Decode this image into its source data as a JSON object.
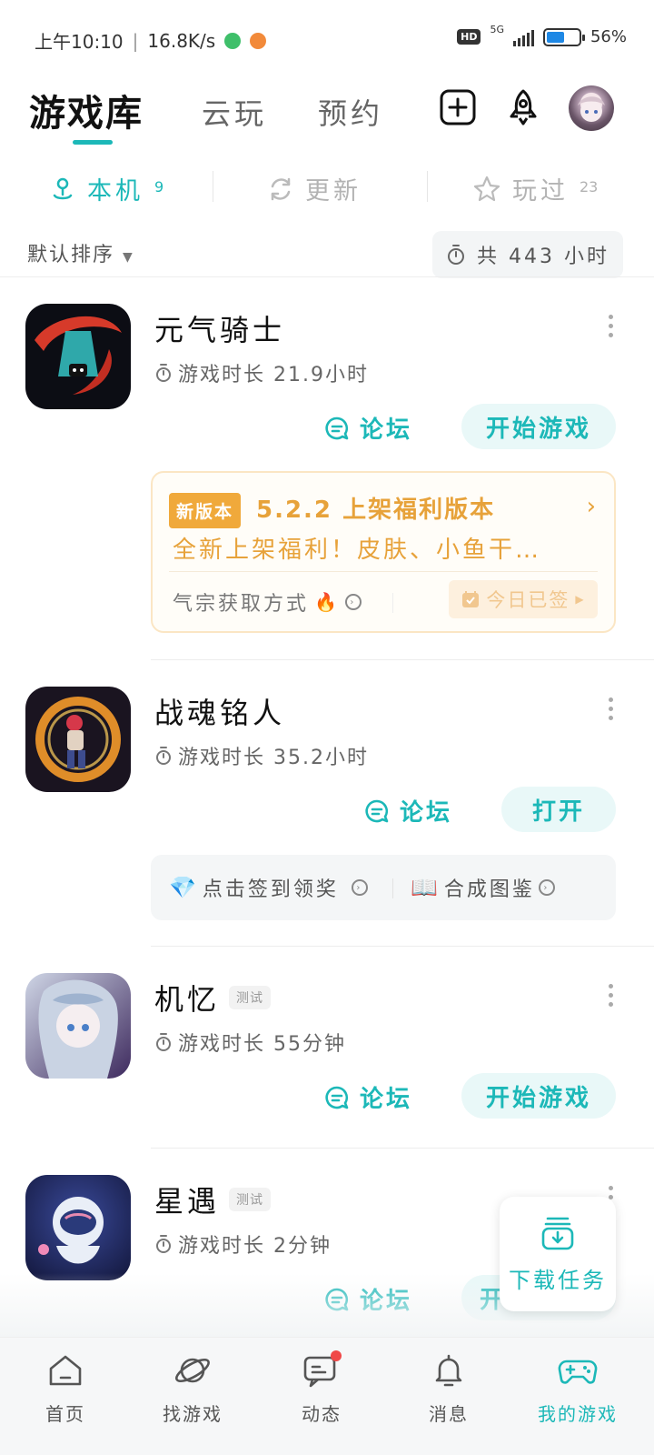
{
  "status_bar": {
    "time": "上午10:10",
    "speed": "16.8K/s",
    "network": "5G",
    "battery": "56%",
    "battery_level": 0.56
  },
  "header": {
    "tab_main": "游戏库",
    "tab_cloud": "云玩",
    "tab_reserve": "预约"
  },
  "subtabs": [
    {
      "label": "本机",
      "count": "9"
    },
    {
      "label": "更新",
      "count": ""
    },
    {
      "label": "玩过",
      "count": "23"
    }
  ],
  "sort": {
    "label": "默认排序"
  },
  "total_time": "共 443 小时",
  "games": [
    {
      "name": "元气骑士",
      "tag": "",
      "time": "游戏时长 21.9小时",
      "forum": "论坛",
      "action": "开始游戏"
    },
    {
      "name": "战魂铭人",
      "tag": "",
      "time": "游戏时长 35.2小时",
      "forum": "论坛",
      "action": "打开"
    },
    {
      "name": "机忆",
      "tag": "测试",
      "time": "游戏时长 55分钟",
      "forum": "论坛",
      "action": "开始游戏"
    },
    {
      "name": "星遇",
      "tag": "测试",
      "time": "游戏时长 2分钟",
      "forum": "论坛",
      "action": "开"
    }
  ],
  "promo": {
    "badge": "新版本",
    "title": "5.2.2 上架福利版本",
    "desc": "全新上架福利！皮肤、小鱼干…",
    "link": "气宗获取方式",
    "signed": "今日已签"
  },
  "quick_links": {
    "checkin": "点击签到领奖",
    "collection": "合成图鉴"
  },
  "download": {
    "label": "下载任务"
  },
  "nav": {
    "home": "首页",
    "find": "找游戏",
    "feed": "动态",
    "messages": "消息",
    "mygames": "我的游戏"
  },
  "colors": {
    "accent": "#1cb8b8",
    "promo": "#e7a23a",
    "badge": "#f0a93b"
  }
}
